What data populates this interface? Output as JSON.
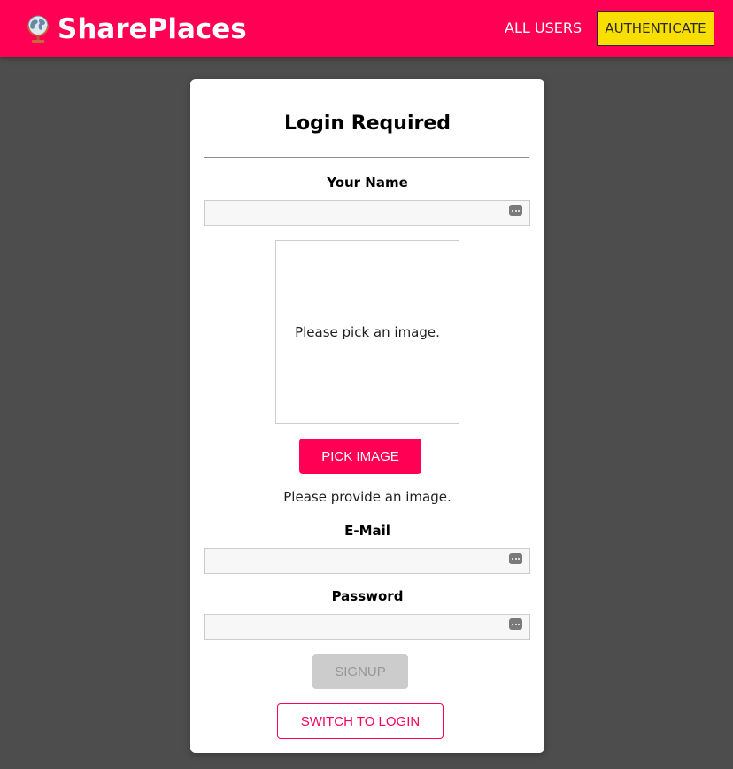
{
  "colors": {
    "brand": "#ff0055",
    "accent_yellow": "#f8df00",
    "page_background": "#4d4d4d",
    "card_background": "#ffffff",
    "disabled": "#cccccc"
  },
  "header": {
    "logo_icon": "globe-icon",
    "title": "SharePlaces",
    "nav": {
      "all_users": "ALL USERS",
      "authenticate": "AUTHENTICATE"
    }
  },
  "card": {
    "title": "Login Required",
    "name_field": {
      "label": "Your Name",
      "value": "",
      "icon": "password-manager-dots-icon"
    },
    "image_picker": {
      "preview_text": "Please pick an image.",
      "button_label": "PICK IMAGE",
      "hint": "Please provide an image."
    },
    "email_field": {
      "label": "E-Mail",
      "value": "",
      "icon": "password-manager-dots-icon"
    },
    "password_field": {
      "label": "Password",
      "value": "",
      "icon": "password-manager-dots-icon"
    },
    "signup_button": "SIGNUP",
    "switch_button": "SWITCH TO LOGIN"
  }
}
